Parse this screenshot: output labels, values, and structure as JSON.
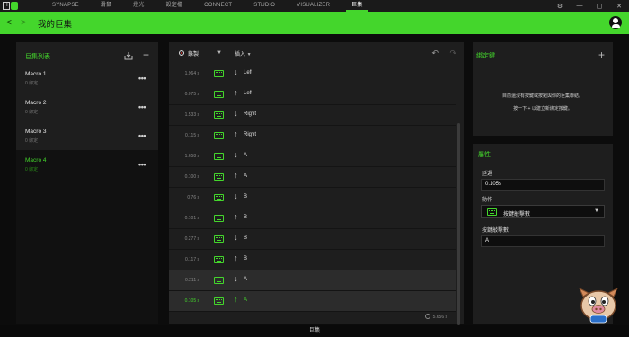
{
  "topbar": {
    "logo_text": "FF",
    "tabs": [
      "SYNAPSE",
      "滑鼠",
      "燈光",
      "設定檔",
      "CONNECT",
      "STUDIO",
      "VISUALIZER",
      "巨集"
    ],
    "active_tab": "巨集"
  },
  "header": {
    "title": "我的巨集"
  },
  "macro_list": {
    "title": "巨集列表",
    "items": [
      {
        "name": "Macro 1",
        "sub": "0 綁定"
      },
      {
        "name": "Macro 2",
        "sub": "0 綁定"
      },
      {
        "name": "Macro 3",
        "sub": "0 綁定"
      },
      {
        "name": "Macro 4",
        "sub": "0 綁定"
      }
    ],
    "selected": "Macro 4"
  },
  "editor": {
    "record_label": "錄製",
    "insert_label": "插入",
    "rows": [
      {
        "delay": "1.964 s",
        "dir": "down",
        "key": "Left"
      },
      {
        "delay": "0.075 s",
        "dir": "up",
        "key": "Left"
      },
      {
        "delay": "1.533 s",
        "dir": "down",
        "key": "Right"
      },
      {
        "delay": "0.115 s",
        "dir": "up",
        "key": "Right"
      },
      {
        "delay": "1.658 s",
        "dir": "down",
        "key": "A"
      },
      {
        "delay": "0.100 s",
        "dir": "up",
        "key": "A"
      },
      {
        "delay": "0.76 s",
        "dir": "down",
        "key": "B"
      },
      {
        "delay": "0.101 s",
        "dir": "up",
        "key": "B"
      },
      {
        "delay": "0.277 s",
        "dir": "down",
        "key": "B"
      },
      {
        "delay": "0.117 s",
        "dir": "up",
        "key": "B"
      },
      {
        "delay": "0.211 s",
        "dir": "down",
        "key": "A"
      },
      {
        "delay": "0.105 s",
        "dir": "up",
        "key": "A"
      }
    ],
    "total": "5.656 s"
  },
  "binding": {
    "title": "綁定鍵",
    "hint1": "目前還沒有按鍵或按鈕與你的巨集聯結。",
    "hint2": "按一下 + 以建立新綁定按鍵。"
  },
  "properties": {
    "title": "屬性",
    "delay_label": "延遲",
    "delay_value": "0.105s",
    "action_label": "動作",
    "action_value": "按鍵敲擊數",
    "keystroke_label": "按鍵敲擊數",
    "keystroke_value": "A"
  },
  "bottombar": {
    "label": "巨集"
  },
  "colors": {
    "accent": "#44d62c",
    "record": "#e0241f"
  },
  "icons": {
    "header": [
      "back-icon",
      "forward-icon",
      "avatar-icon"
    ],
    "macro_list": [
      "import-icon",
      "add-icon",
      "more-icon"
    ],
    "editor": [
      "record-icon",
      "chevron-down-icon",
      "keyboard-icon",
      "key-down-arrow-icon",
      "key-up-arrow-icon",
      "undo-icon",
      "redo-icon",
      "clock-icon"
    ]
  }
}
